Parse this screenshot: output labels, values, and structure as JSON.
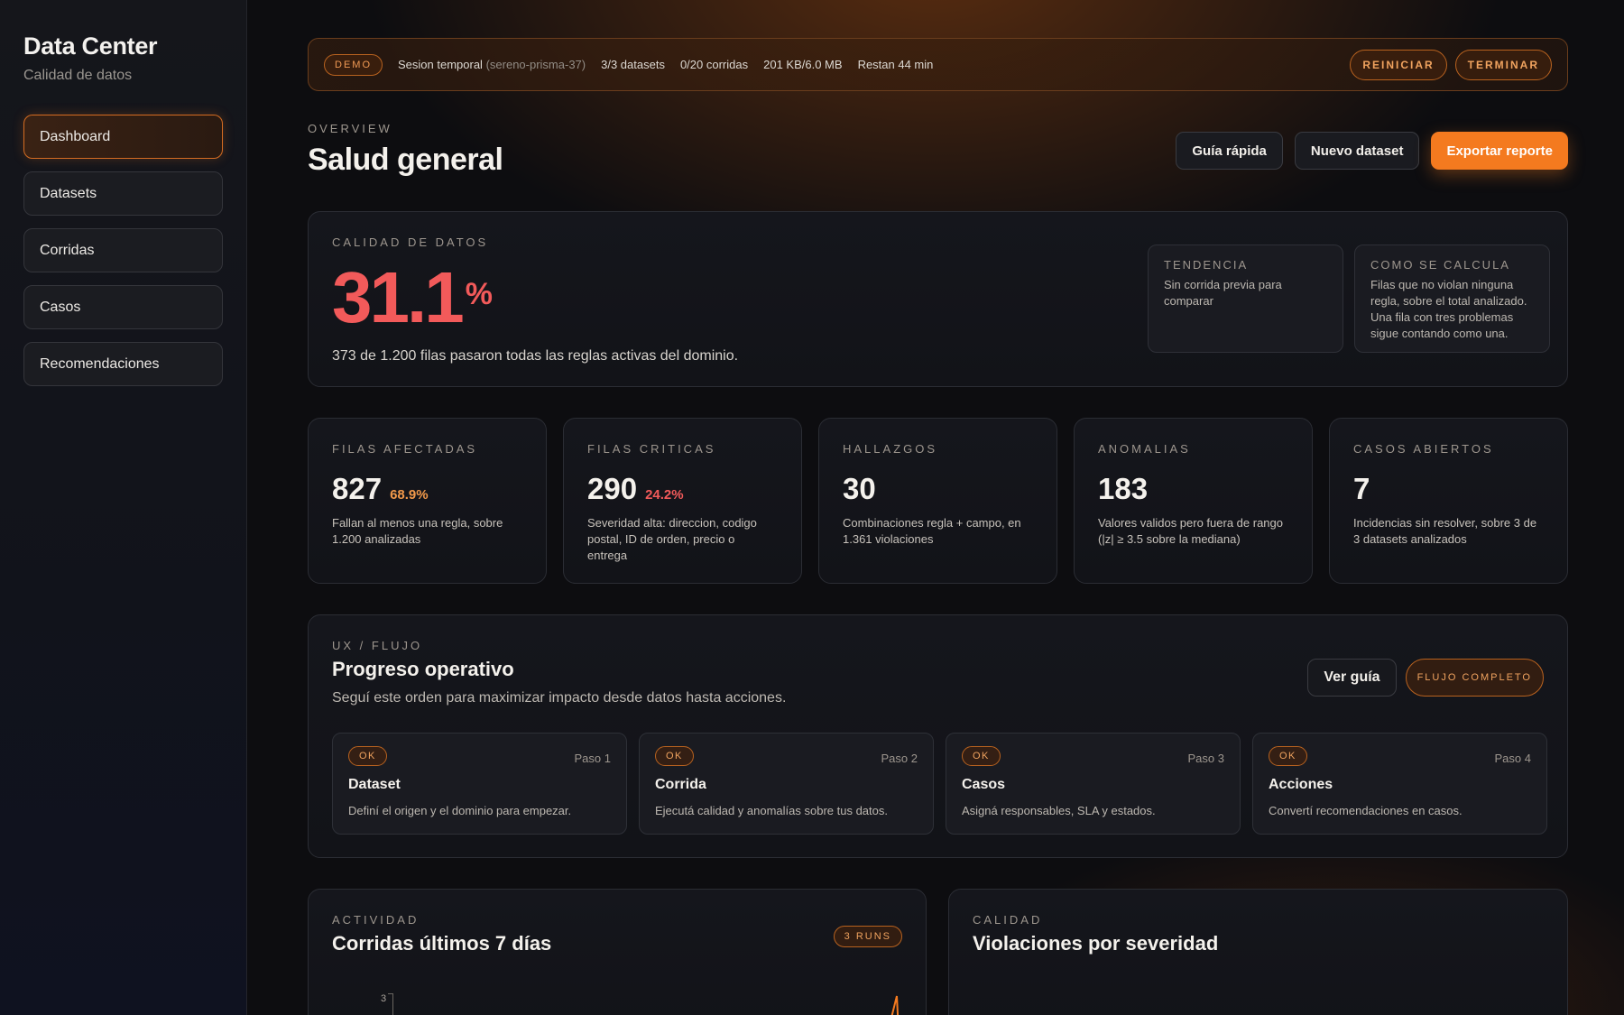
{
  "brand": {
    "title": "Data Center",
    "subtitle": "Calidad de datos"
  },
  "nav": [
    {
      "label": "Dashboard",
      "active": true
    },
    {
      "label": "Datasets"
    },
    {
      "label": "Corridas"
    },
    {
      "label": "Casos"
    },
    {
      "label": "Recomendaciones"
    }
  ],
  "session": {
    "badge": "DEMO",
    "label": "Sesion temporal",
    "session_id": "(sereno-prisma-37)",
    "datasets": "3/3 datasets",
    "runs": "0/20 corridas",
    "storage": "201 KB/6.0 MB",
    "remaining": "Restan 44 min",
    "restart_label": "REINICIAR",
    "end_label": "TERMINAR"
  },
  "header": {
    "eyebrow": "OVERVIEW",
    "title": "Salud general",
    "quick_guide": "Guía rápida",
    "new_dataset": "Nuevo dataset",
    "export": "Exportar reporte"
  },
  "quality": {
    "label": "CALIDAD DE DATOS",
    "value": "31.1",
    "unit": "%",
    "description": "373 de 1.200 filas pasaron todas las reglas activas del dominio.",
    "trend_label": "TENDENCIA",
    "trend_text": "Sin corrida previa para comparar",
    "calc_label": "COMO SE CALCULA",
    "calc_text": "Filas que no violan ninguna regla, sobre el total analizado. Una fila con tres problemas sigue contando como una."
  },
  "kpis": [
    {
      "label": "FILAS AFECTADAS",
      "value": "827",
      "pct": "68.9%",
      "pct_color": "#f2994a",
      "desc": "Fallan al menos una regla, sobre 1.200 analizadas"
    },
    {
      "label": "FILAS CRITICAS",
      "value": "290",
      "pct": "24.2%",
      "pct_color": "#f25a5a",
      "desc": "Severidad alta: direccion, codigo postal, ID de orden, precio o entrega"
    },
    {
      "label": "HALLAZGOS",
      "value": "30",
      "pct": "",
      "pct_color": "",
      "desc": "Combinaciones regla + campo, en 1.361 violaciones"
    },
    {
      "label": "ANOMALIAS",
      "value": "183",
      "pct": "",
      "pct_color": "",
      "desc": "Valores validos pero fuera de rango (|z| ≥ 3.5 sobre la mediana)"
    },
    {
      "label": "CASOS ABIERTOS",
      "value": "7",
      "pct": "",
      "pct_color": "",
      "desc": "Incidencias sin resolver, sobre 3 de 3 datasets analizados"
    }
  ],
  "flow": {
    "eyebrow": "UX / FLUJO",
    "title": "Progreso operativo",
    "description": "Seguí este orden para maximizar impacto desde datos hasta acciones.",
    "guide_button": "Ver guía",
    "status_pill": "FLUJO COMPLETO",
    "steps": [
      {
        "status": "OK",
        "step": "Paso 1",
        "title": "Dataset",
        "desc": "Definí el origen y el dominio para empezar."
      },
      {
        "status": "OK",
        "step": "Paso 2",
        "title": "Corrida",
        "desc": "Ejecutá calidad y anomalías sobre tus datos."
      },
      {
        "status": "OK",
        "step": "Paso 3",
        "title": "Casos",
        "desc": "Asigná responsables, SLA y estados."
      },
      {
        "status": "OK",
        "step": "Paso 4",
        "title": "Acciones",
        "desc": "Convertí recomendaciones en casos."
      }
    ]
  },
  "activity": {
    "eyebrow": "ACTIVIDAD",
    "title": "Corridas últimos 7 días",
    "runs_pill": "3 RUNS",
    "y_tick": "3"
  },
  "severity": {
    "eyebrow": "CALIDAD",
    "title": "Violaciones por severidad"
  }
}
